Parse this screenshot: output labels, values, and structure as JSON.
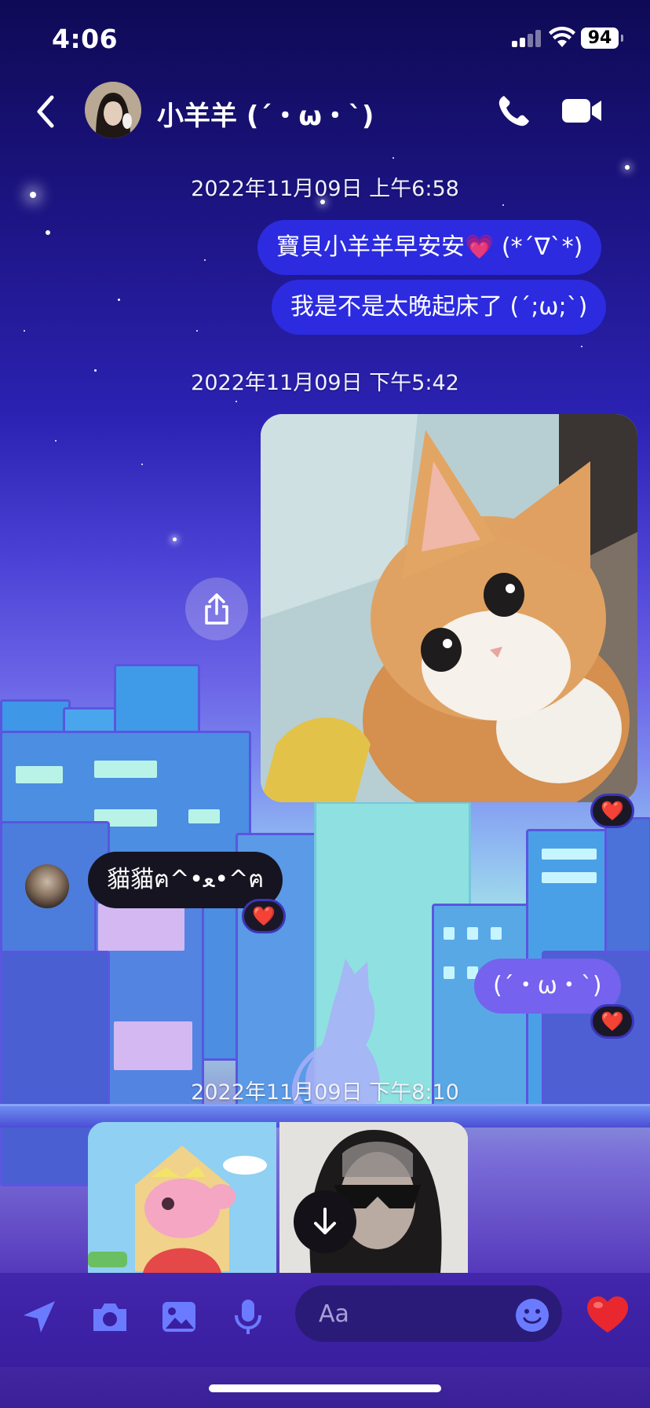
{
  "status_bar": {
    "time": "4:06",
    "battery": "94",
    "icons": [
      "cellular-signal-icon",
      "wifi-icon",
      "battery-icon"
    ]
  },
  "header": {
    "contact_name": "小羊羊 (´・ω・`)",
    "icons": [
      "back-chevron-icon",
      "phone-icon",
      "video-camera-icon"
    ]
  },
  "messages": {
    "ts1": "2022年11月09日 上午6:58",
    "out1": "寶貝小羊羊早安安💗 (*´∇`*)",
    "out2": "我是不是太晚起床了 (´;ω;`)",
    "ts2": "2022年11月09日 下午5:42",
    "in1": "貓貓ฅ^•ﻌ•^ฅ",
    "out3": "(´・ω・`)",
    "ts3": "2022年11月09日 下午8:10",
    "reaction": "❤️"
  },
  "composer": {
    "placeholder": "Aa",
    "icons": [
      "location-arrow-icon",
      "camera-icon",
      "gallery-icon",
      "microphone-icon",
      "emoji-icon",
      "heart-icon"
    ]
  },
  "colors": {
    "outgoing_bubble": "#2c2be0",
    "incoming_bubble": "#161420",
    "outgoing_light_bubble": "#7562ee",
    "heart": "#e8282e"
  }
}
